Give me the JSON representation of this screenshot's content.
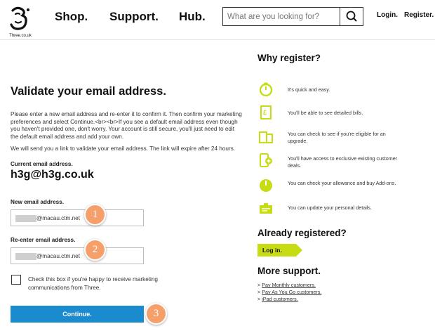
{
  "header": {
    "logo_text": "Three.co.uk",
    "nav": [
      "Shop.",
      "Support.",
      "Hub."
    ],
    "search_placeholder": "What are you looking for?",
    "login": "Login.",
    "register": "Register."
  },
  "form": {
    "title": "Validate your email address.",
    "intro": "Please enter a new email address and re-enter it to confirm it. Then confirm your marketing preferences and select Continue.<br><br>If you see a default email address even though you haven't provided one, don't worry. Your account is still secure, you'll just need to edit the default email address and add your own.",
    "note": "We will send you a link to validate your email address. The link will expire after 24 hours.",
    "current_label": "Current email address.",
    "current_value": "h3g@h3g.co.uk",
    "new_label": "New email address.",
    "new_value": "@macau.ctm.net",
    "reenter_label": "Re-enter email address.",
    "reenter_value": "@macau.ctm.net",
    "checkbox_text": "Check this box if you're happy to receive marketing communications from Three.",
    "checkbox_checked": false,
    "continue_label": "Continue."
  },
  "markers": [
    "1",
    "2",
    "3"
  ],
  "sidebar": {
    "why_title": "Why register?",
    "benefits": [
      {
        "icon": "stopwatch-icon",
        "text": "It's quick and easy."
      },
      {
        "icon": "bill-icon",
        "text": "You'll be able to see detailed bills."
      },
      {
        "icon": "devices-icon",
        "text": "You can check to see if you're eligible for an upgrade."
      },
      {
        "icon": "phone-plus-icon",
        "text": "You'll have access to exclusive existing customer deals."
      },
      {
        "icon": "gauge-icon",
        "text": "You can check your allowance and buy Add-ons."
      },
      {
        "icon": "id-card-icon",
        "text": "You can update your personal details."
      }
    ],
    "already_title": "Already registered?",
    "login_label": "Log in.",
    "support_title": "More support.",
    "support_links": [
      "Pay Monthly customers.",
      "Pay As You Go customers.",
      "iPad customers."
    ]
  },
  "colors": {
    "accent_green": "#c8dc14",
    "button_blue": "#1b8bd0",
    "marker_orange": "#f5a06a"
  }
}
